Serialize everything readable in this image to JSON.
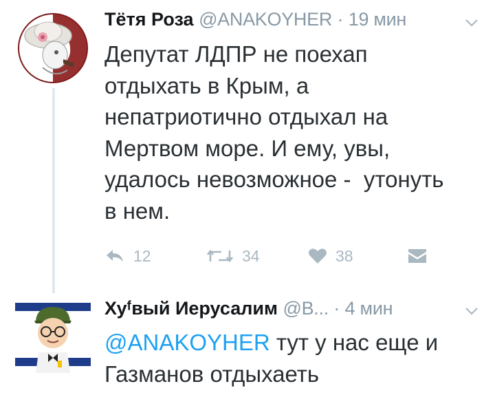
{
  "tweets": [
    {
      "author_name": "Тётя Роза",
      "handle": "@ANAKOYHER",
      "separator": "·",
      "time": "19 мин",
      "text": "Депутат ЛДПР не поехап\nотдыхать в Крым, а\nнепатриотично отдыхал на\nМертвом море. И ему, увы,\nудалось невозможное -  утонуть\nв нем.",
      "actions": {
        "reply_count": "12",
        "retweet_count": "34",
        "like_count": "38"
      },
      "avatar_icon": "lady-with-hat-avatar-icon"
    },
    {
      "author_name": "Хуᶠвый Иерусалим",
      "handle": "@B...",
      "separator": "·",
      "time": "4 мин",
      "mention": "@ANAKOYHER",
      "text_rest": " тут у нас еще и\nГазманов отдыхаеть",
      "avatar_icon": "soldier-avatar-icon"
    }
  ],
  "colors": {
    "link": "#1da1f2",
    "meta": "#8899a6",
    "action": "#aab8c2",
    "thread": "#e1e8ed"
  }
}
